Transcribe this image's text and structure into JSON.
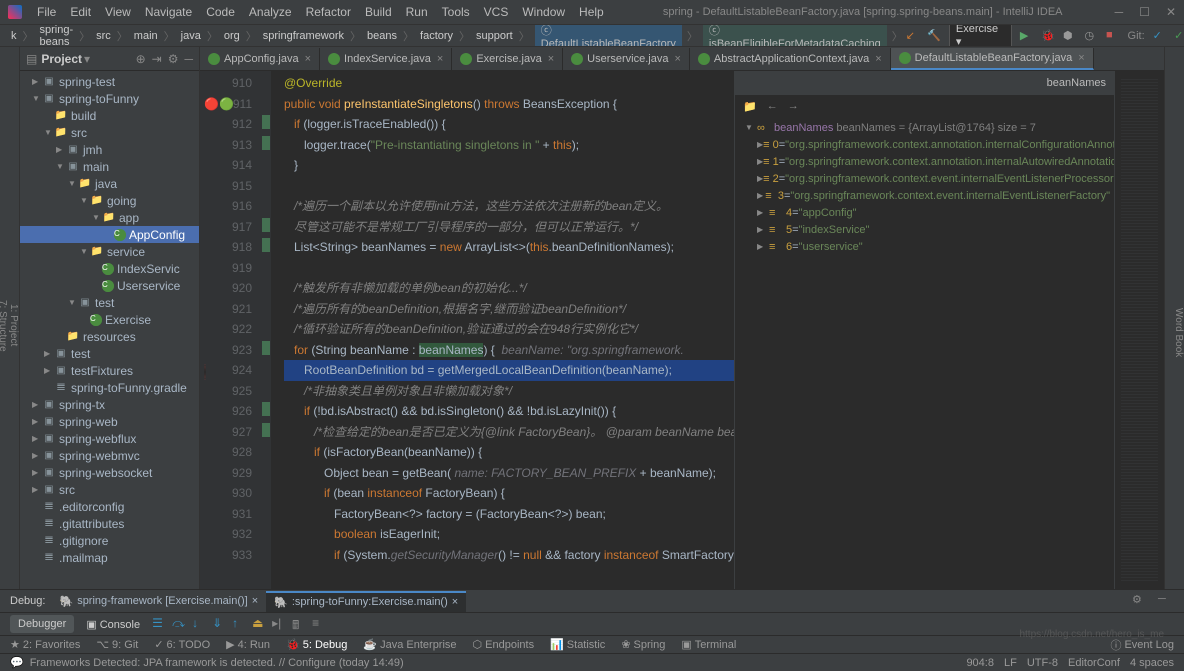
{
  "title_path": "spring - DefaultListableBeanFactory.java [spring.spring-beans.main] - IntelliJ IDEA",
  "menu": [
    "File",
    "Edit",
    "View",
    "Navigate",
    "Code",
    "Analyze",
    "Refactor",
    "Build",
    "Run",
    "Tools",
    "VCS",
    "Window",
    "Help"
  ],
  "breadcrumb": [
    "k",
    "spring-beans",
    "src",
    "main",
    "java",
    "org",
    "springframework",
    "beans",
    "factory",
    "support"
  ],
  "breadcrumb_badges": [
    {
      "text": "DefaultListableBeanFactory",
      "cls": "blue"
    },
    {
      "text": "isBeanEligibleForMetadataCaching",
      "cls": ""
    }
  ],
  "run_config": "Exercise",
  "git_label": "Git:",
  "project_label": "Project",
  "left_gutter": [
    "1: Project",
    "7: Structure",
    "2: Favorites"
  ],
  "right_gutter_items": [
    "Word Book"
  ],
  "tree": [
    {
      "indent": 1,
      "arrow": "▶",
      "icon": "module",
      "label": "spring-test"
    },
    {
      "indent": 1,
      "arrow": "▼",
      "icon": "module",
      "label": "spring-toFunny"
    },
    {
      "indent": 2,
      "arrow": "",
      "icon": "folder",
      "label": "build"
    },
    {
      "indent": 2,
      "arrow": "▼",
      "icon": "folder",
      "label": "src"
    },
    {
      "indent": 3,
      "arrow": "▶",
      "icon": "module",
      "label": "jmh"
    },
    {
      "indent": 3,
      "arrow": "▼",
      "icon": "module",
      "label": "main"
    },
    {
      "indent": 4,
      "arrow": "▼",
      "icon": "folder",
      "label": "java"
    },
    {
      "indent": 5,
      "arrow": "▼",
      "icon": "folder",
      "label": "going"
    },
    {
      "indent": 6,
      "arrow": "▼",
      "icon": "folder",
      "label": "app"
    },
    {
      "indent": 7,
      "arrow": "",
      "icon": "class",
      "label": "AppConfig",
      "selected": true
    },
    {
      "indent": 5,
      "arrow": "▼",
      "icon": "folder",
      "label": "service"
    },
    {
      "indent": 6,
      "arrow": "",
      "icon": "class",
      "label": "IndexServic"
    },
    {
      "indent": 6,
      "arrow": "",
      "icon": "class",
      "label": "Userservice"
    },
    {
      "indent": 4,
      "arrow": "▼",
      "icon": "module",
      "label": "test"
    },
    {
      "indent": 5,
      "arrow": "",
      "icon": "class",
      "label": "Exercise"
    },
    {
      "indent": 3,
      "arrow": "",
      "icon": "folder",
      "label": "resources"
    },
    {
      "indent": 2,
      "arrow": "▶",
      "icon": "module",
      "label": "test"
    },
    {
      "indent": 2,
      "arrow": "▶",
      "icon": "module",
      "label": "testFixtures"
    },
    {
      "indent": 2,
      "arrow": "",
      "icon": "file",
      "label": "spring-toFunny.gradle"
    },
    {
      "indent": 1,
      "arrow": "▶",
      "icon": "module",
      "label": "spring-tx"
    },
    {
      "indent": 1,
      "arrow": "▶",
      "icon": "module",
      "label": "spring-web"
    },
    {
      "indent": 1,
      "arrow": "▶",
      "icon": "module",
      "label": "spring-webflux"
    },
    {
      "indent": 1,
      "arrow": "▶",
      "icon": "module",
      "label": "spring-webmvc"
    },
    {
      "indent": 1,
      "arrow": "▶",
      "icon": "module",
      "label": "spring-websocket"
    },
    {
      "indent": 1,
      "arrow": "▶",
      "icon": "module",
      "label": "src"
    },
    {
      "indent": 1,
      "arrow": "",
      "icon": "file",
      "label": ".editorconfig"
    },
    {
      "indent": 1,
      "arrow": "",
      "icon": "file",
      "label": ".gitattributes"
    },
    {
      "indent": 1,
      "arrow": "",
      "icon": "file",
      "label": ".gitignore"
    },
    {
      "indent": 1,
      "arrow": "",
      "icon": "file",
      "label": ".mailmap"
    }
  ],
  "tabs": [
    {
      "label": "AppConfig.java",
      "icon": "#4a8c3f"
    },
    {
      "label": "IndexService.java",
      "icon": "#4a8c3f"
    },
    {
      "label": "Exercise.java",
      "icon": "#4a8c3f"
    },
    {
      "label": "Userservice.java",
      "icon": "#4a8c3f"
    },
    {
      "label": "AbstractApplicationContext.java",
      "icon": "#4a8c3f"
    },
    {
      "label": "DefaultListableBeanFactory.java",
      "icon": "#4a8c3f",
      "active": true
    }
  ],
  "line_start": 910,
  "line_count": 25,
  "code_lines": [
    {
      "n": 910,
      "html": "<span class='ann'>@Override</span>"
    },
    {
      "n": 911,
      "html": "<span class='kw'>public void</span> <span class='method'>preInstantiateSingletons</span>() <span class='kw'>throws</span> BeansException {"
    },
    {
      "n": 912,
      "html": "   <span class='kw'>if</span> (logger.isTraceEnabled()) {"
    },
    {
      "n": 913,
      "html": "      logger.trace(<span class='str'>\"Pre-instantiating singletons in \"</span> + <span class='kw'>this</span>);"
    },
    {
      "n": 914,
      "html": "   }"
    },
    {
      "n": 915,
      "html": ""
    },
    {
      "n": 916,
      "html": "   <span class='cmt'>/*遍历一个副本以允许使用init方法，这些方法依次注册新的bean定义。</span>"
    },
    {
      "n": 917,
      "html": "   <span class='cmt'>尽管这可能不是常规工厂引导程序的一部分，但可以正常运行。*/</span>"
    },
    {
      "n": 918,
      "html": "   List&lt;String&gt; beanNames = <span class='kw'>new</span> ArrayList&lt;&gt;(<span class='kw'>this</span>.beanDefinitionNames);"
    },
    {
      "n": 919,
      "html": ""
    },
    {
      "n": 920,
      "html": "   <span class='cmt'>/*触发所有非懒加载的单例bean的初始化...*/</span>"
    },
    {
      "n": 921,
      "html": "   <span class='cmt'>/*遍历所有的beanDefinition,根据名字,继而验证beanDefinition*/</span>"
    },
    {
      "n": 922,
      "html": "   <span class='cmt'>/*循环验证所有的beanDefinition,验证通过的会在948行实例化它*/</span>"
    },
    {
      "n": 923,
      "html": "   <span class='kw'>for</span> (String beanName : <span style='background:#32593d'>beanNames</span>) {  <span class='param'>beanName: \"org.springframework.</span>"
    },
    {
      "n": 924,
      "html": "<span class='highlight'>      RootBeanDefinition bd = getMergedLocalBeanDefinition(beanName);</span>",
      "bp": true
    },
    {
      "n": 925,
      "html": "      <span class='cmt'>/*非抽象类且单例对象且非懒加载对象*/</span>"
    },
    {
      "n": 926,
      "html": "      <span class='kw'>if</span> (!bd.isAbstract() && bd.isSingleton() && !bd.isLazyInit()) {"
    },
    {
      "n": 927,
      "html": "         <span class='cmt'>/*检查给定的bean是否已定义为{@link FactoryBean}。 @param beanName bean的名称@param mbd对应的bean定义*/</span>"
    },
    {
      "n": 928,
      "html": "         <span class='kw'>if</span> (isFactoryBean(beanName)) {"
    },
    {
      "n": 929,
      "html": "            Object bean = getBean( <span class='param'>name:</span> <span class='param'>FACTORY_BEAN_PREFIX</span> + beanName);"
    },
    {
      "n": 930,
      "html": "            <span class='kw'>if</span> (bean <span class='kw'>instanceof</span> FactoryBean) {"
    },
    {
      "n": 931,
      "html": "               FactoryBean&lt;?&gt; factory = (FactoryBean&lt;?&gt;) bean;"
    },
    {
      "n": 932,
      "html": "               <span class='kw'>boolean</span> isEagerInit;"
    },
    {
      "n": 933,
      "html": "               <span class='kw'>if</span> (System.<span class='param'>getSecurityManager</span>() != <span class='kw'>null</span> && factory <span class='kw'>instanceof</span> SmartFactoryBean) {"
    }
  ],
  "debug_var_title": "beanNames",
  "debug_root": "beanNames = {ArrayList@1764}  size = 7",
  "debug_vars": [
    {
      "idx": "0",
      "val": "\"org.springframework.context.annotation.internalConfigurationAnnota"
    },
    {
      "idx": "1",
      "val": "\"org.springframework.context.annotation.internalAutowiredAnnotatio"
    },
    {
      "idx": "2",
      "val": "\"org.springframework.context.event.internalEventListenerProcessor\""
    },
    {
      "idx": "3",
      "val": "\"org.springframework.context.event.internalEventListenerFactory\""
    },
    {
      "idx": "4",
      "val": "\"appConfig\""
    },
    {
      "idx": "5",
      "val": "\"indexService\""
    },
    {
      "idx": "6",
      "val": "\"userservice\""
    }
  ],
  "bottom_debug_tabs": [
    {
      "label": "spring-framework [Exercise.main()]"
    },
    {
      "label": ":spring-toFunny:Exercise.main()",
      "active": true
    }
  ],
  "debug_label": "Debug:",
  "dbg_buttons": {
    "debugger": "Debugger",
    "console": "Console"
  },
  "strip": [
    {
      "icon": "⌥",
      "label": "9: Git"
    },
    {
      "icon": "✓",
      "label": "6: TODO"
    },
    {
      "icon": "▶",
      "label": "4: Run"
    },
    {
      "icon": "🐞",
      "label": "5: Debug",
      "active": true
    },
    {
      "icon": "☕",
      "label": "Java Enterprise"
    },
    {
      "icon": "⬡",
      "label": "Endpoints"
    },
    {
      "icon": "📊",
      "label": "Statistic"
    },
    {
      "icon": "❀",
      "label": "Spring"
    },
    {
      "icon": "▣",
      "label": "Terminal"
    }
  ],
  "event_log": "Event Log",
  "status_msg": "Frameworks Detected: JPA framework is detected. // Configure (today 14:49)",
  "status_right": [
    "904:8",
    "LF",
    "UTF-8",
    "EditorConf",
    "4 spaces"
  ],
  "watermark": "https://blog.csdn.net/hero_is_me"
}
